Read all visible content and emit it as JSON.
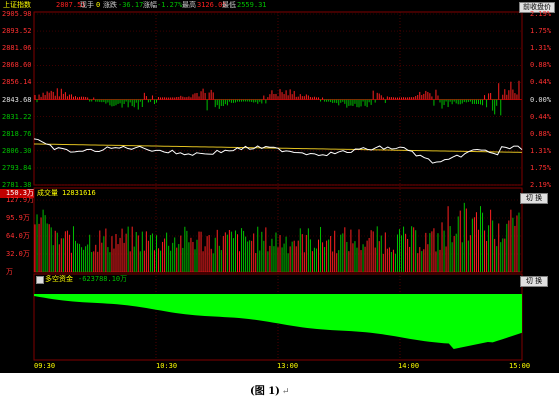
{
  "header": {
    "index_name": "上证指数",
    "price_label": "2807.51",
    "volume_label": "现手",
    "volume_value": "0",
    "change_label": "涨跌",
    "change_value": "-36.17",
    "pct_label": "涨幅",
    "pct_value": "-1.27%",
    "high_label": "最高",
    "high_value": "3126.05",
    "low_label": "最低",
    "low_value": "2559.31",
    "top_button": "前收盘价"
  },
  "price_panel": {
    "left_ticks": [
      "2905.98",
      "2893.52",
      "2881.06",
      "2868.60",
      "2856.14",
      "2843.68",
      "2831.22",
      "2818.76",
      "2806.30",
      "2793.84",
      "2781.38"
    ],
    "right_ticks": [
      "2.19%",
      "1.75%",
      "1.31%",
      "0.88%",
      "0.44%",
      "0.00%",
      "0.44%",
      "0.88%",
      "1.31%",
      "1.75%",
      "2.19%"
    ]
  },
  "volume_panel": {
    "current_value": "150.3万",
    "label": "成交量",
    "value": "12831616",
    "ticks": [
      "127.9万",
      "95.9万",
      "64.0万",
      "32.0万",
      "万"
    ],
    "switch_button": "切 换"
  },
  "flow_panel": {
    "label": "多空资金",
    "value": "-623788.10万",
    "switch_button": "切 换"
  },
  "time_axis": [
    "09:30",
    "10:30",
    "13:00",
    "14:00",
    "15:00"
  ],
  "caption": {
    "text": "(图 1)",
    "mark": "↵"
  },
  "colors": {
    "background": "#000000",
    "up": "#ff2020",
    "down": "#00c000",
    "price_line": "#ffffff",
    "avg_line": "#e0c020",
    "fill": "#00ff00",
    "axis_red": "#e03030"
  }
}
